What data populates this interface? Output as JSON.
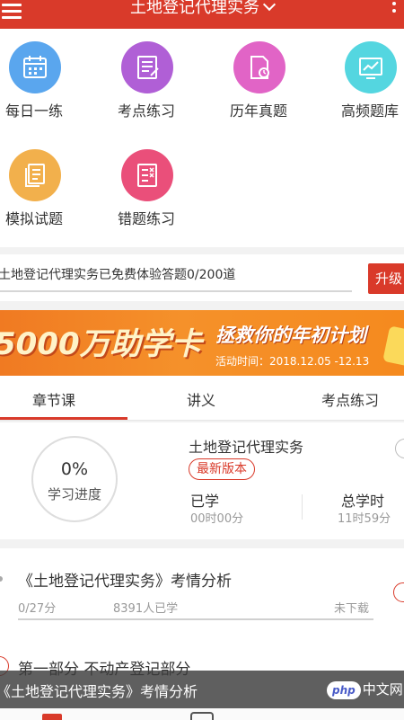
{
  "header": {
    "title": "土地登记代理实务",
    "menu_icon": "menu-icon",
    "more_icon": "more-vertical-icon"
  },
  "grid": {
    "items": [
      {
        "label": "每日一练",
        "icon": "calendar-icon",
        "color": "#5aa6ee"
      },
      {
        "label": "考点练习",
        "icon": "notebook-icon",
        "color": "#b05fd6"
      },
      {
        "label": "历年真题",
        "icon": "document-clock-icon",
        "color": "#e164c6"
      },
      {
        "label": "高频题库",
        "icon": "chart-board-icon",
        "color": "#54d6e0"
      },
      {
        "label": "模拟试题",
        "icon": "paper-stack-icon",
        "color": "#f2b04c"
      },
      {
        "label": "错题练习",
        "icon": "wrong-list-icon",
        "color": "#ea4f7a"
      }
    ]
  },
  "free_trial": {
    "text": "土地登记代理实务已免费体验答题0/200道",
    "upgrade_label": "升级",
    "progress": 0
  },
  "banner": {
    "headline": "5000万助学卡",
    "slogan": "拯救你的年初计划",
    "date": "活动时间：2018.12.05 -12.13"
  },
  "tabs": [
    "章节课",
    "讲义",
    "考点练习"
  ],
  "course": {
    "percent": "0%",
    "percent_label": "学习进度",
    "title": "土地登记代理实务",
    "badge": "最新版本",
    "learned_label": "已学",
    "learned_value": "00时00分",
    "total_label": "总学时",
    "total_value": "11时59分"
  },
  "list": {
    "items": [
      {
        "title": "《土地登记代理实务》考情分析",
        "count": "0/27分",
        "learners": "8391人已学",
        "status": "未下载"
      },
      {
        "title": "第一部分 不动产登记部分"
      }
    ]
  },
  "caption": {
    "text": "《土地登记代理实务》考情分析",
    "watermark_php": "php",
    "watermark_cn": "中文网"
  },
  "colors": {
    "brand": "#d93a2a",
    "banner": "#f5912a"
  }
}
